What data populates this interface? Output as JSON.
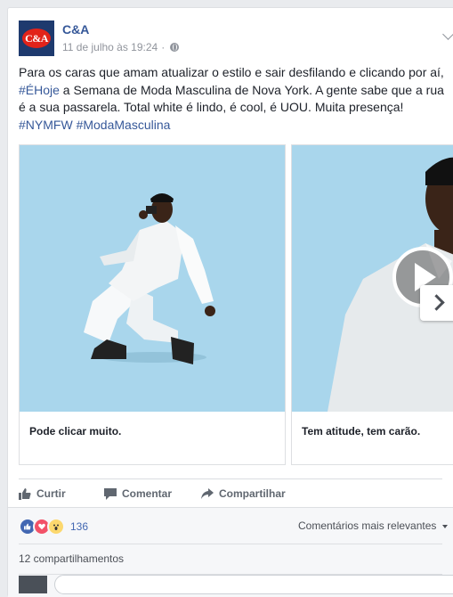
{
  "post": {
    "page_name": "C&A",
    "logo_text": "C&A",
    "timestamp": "11 de julho às 19:24",
    "separator": "·",
    "text_part1": "Para os caras que amam atualizar o estilo e sair desfilando e clicando por aí, ",
    "hashtag1": "#ÉHoje",
    "text_part2": " a Semana de Moda Masculina de Nova York. A gente sabe que a rua é a sua passarela. Total white é lindo, é cool, é UOU. Muita presença! ",
    "hashtag2": "#NYMFW",
    "hashtag3": "#ModaMasculina"
  },
  "carousel": {
    "cards": [
      {
        "caption": "Pode clicar muito."
      },
      {
        "caption": "Tem atitude, tem carão."
      }
    ],
    "image_bg": "#a9d6ec"
  },
  "actions": {
    "like": "Curtir",
    "comment": "Comentar",
    "share": "Compartilhar"
  },
  "reactions": {
    "count": "136",
    "types": [
      "like-icon",
      "love-icon",
      "wow-icon"
    ],
    "sort_label": "Comentários mais relevantes"
  },
  "shares": {
    "label": "12 compartilhamentos"
  },
  "colors": {
    "link": "#365899",
    "like_blue": "#4267b2",
    "love_red": "#f25268",
    "wow_yellow": "#fcd86e"
  }
}
